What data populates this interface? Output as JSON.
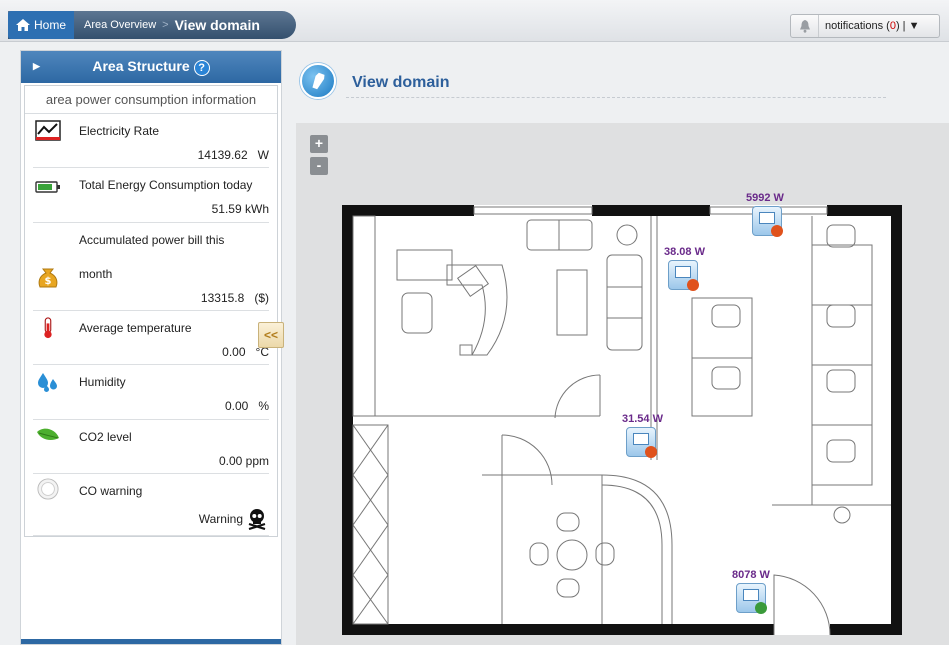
{
  "breadcrumb": {
    "home": "Home",
    "section": "Area Overview",
    "separator": ">",
    "current": "View domain"
  },
  "notifications": {
    "label": "notifications (",
    "count": "0",
    "suffix": ") | ▼"
  },
  "sidebar": {
    "title": "Area Structure",
    "help": "?",
    "info_title": "area power consumption information",
    "collapse": "<<",
    "metrics": [
      {
        "icon": "chart-icon",
        "name": "Electricity Rate",
        "value": "14139.62",
        "unit": "W"
      },
      {
        "icon": "battery-icon",
        "name": "Total Energy Consumption today",
        "value": "51.59 kWh",
        "unit": ""
      },
      {
        "icon": "money-bag-icon",
        "name_line1": "Accumulated power bill this",
        "name_line2": "month",
        "value": "13315.8",
        "unit": "($)"
      },
      {
        "icon": "thermometer-icon",
        "name": "Average temperature",
        "value": "0.00",
        "unit": "°C"
      },
      {
        "icon": "water-drops-icon",
        "name": "Humidity",
        "value": "0.00",
        "unit": "%"
      },
      {
        "icon": "leaf-icon",
        "name": "CO2 level",
        "value": "0.00 ppm",
        "unit": ""
      },
      {
        "icon": "co-sensor-icon",
        "name": "CO warning",
        "value": "Warning",
        "unit": ""
      }
    ]
  },
  "main": {
    "title": "View domain",
    "zoom_in": "+",
    "zoom_out": "-"
  },
  "devices": [
    {
      "reading": "5992 W",
      "status": "alert"
    },
    {
      "reading": "38.08 W",
      "status": "alert"
    },
    {
      "reading": "31.54 W",
      "status": "alert"
    },
    {
      "reading": "8078 W",
      "status": "ok"
    }
  ],
  "colors": {
    "accent": "#2d68a3",
    "title": "#2d5f9b",
    "device_label": "#6a2a8a",
    "alert": "#e0521c",
    "ok": "#3a9a3a"
  }
}
